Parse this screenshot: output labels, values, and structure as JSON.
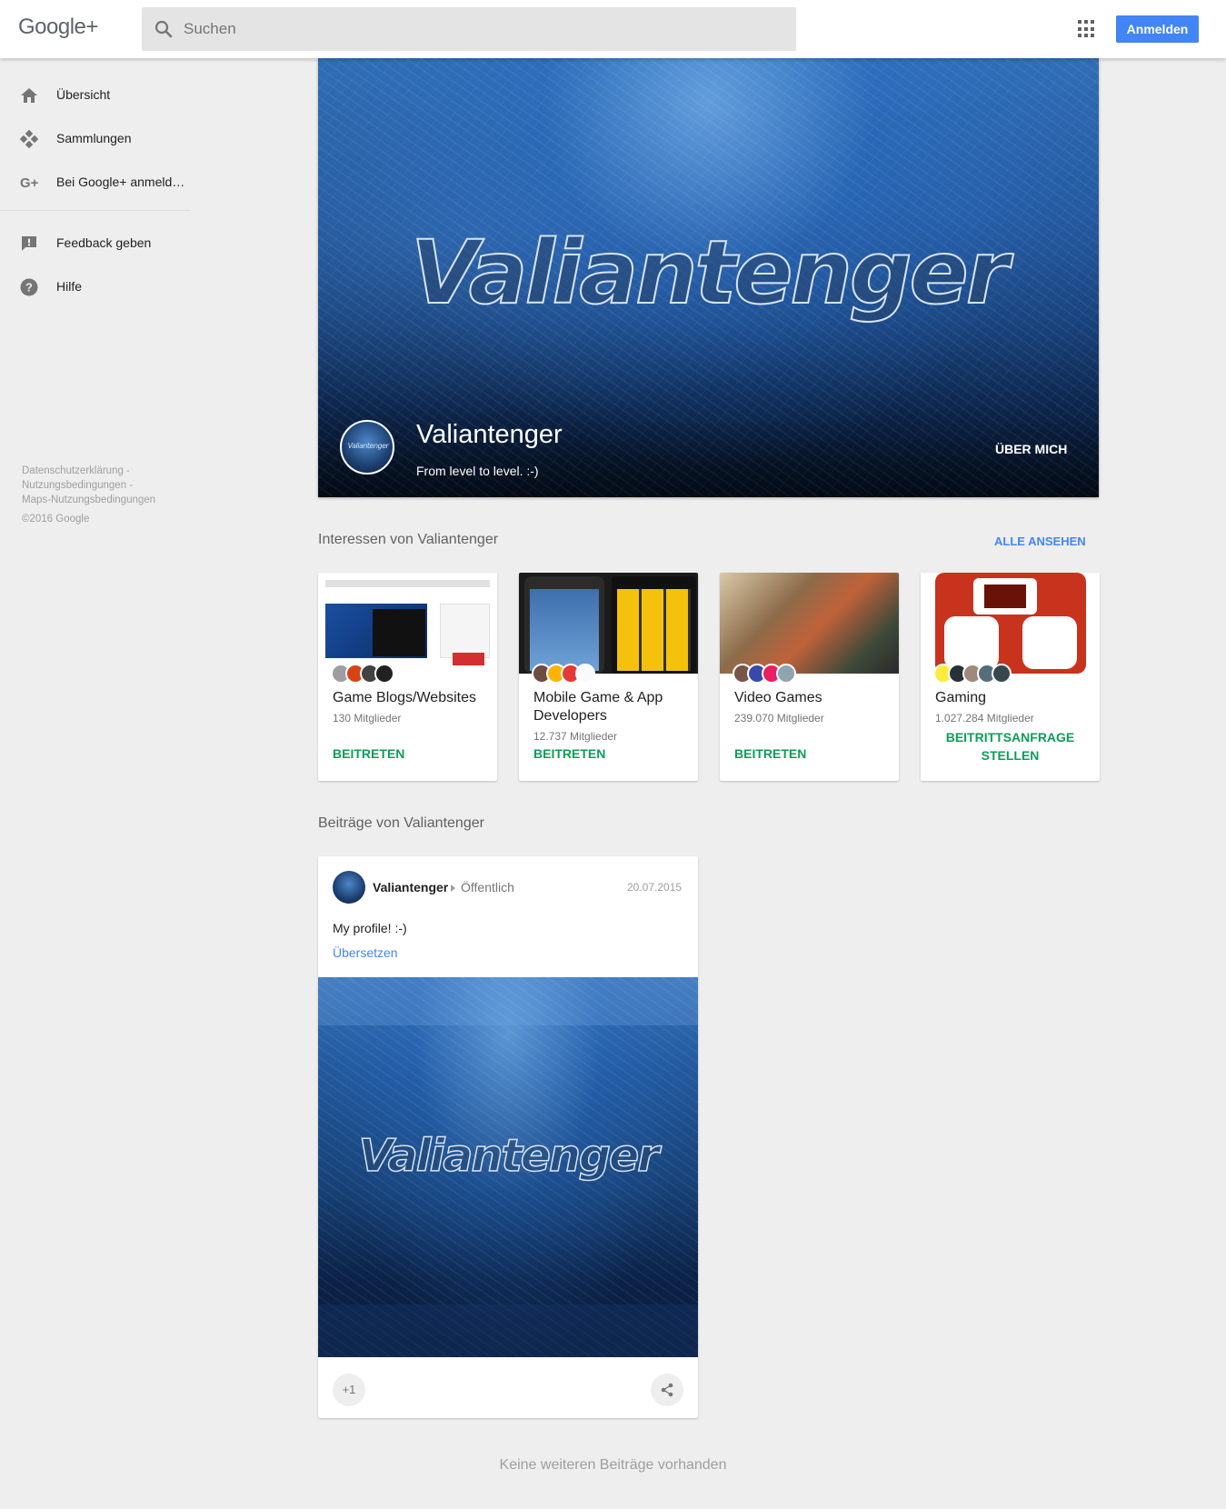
{
  "header": {
    "logo": "Google+",
    "search": {
      "placeholder": "Suchen"
    },
    "apps_icon": "apps-grid-icon",
    "signin_label": "Anmelden",
    "accent": "#4285f4"
  },
  "sidebar": {
    "items": [
      {
        "label": "Übersicht",
        "icon": "home-icon"
      },
      {
        "label": "Sammlungen",
        "icon": "collections-icon"
      },
      {
        "label": "Bei Google+ anmeld…",
        "icon": "google-plus-icon"
      },
      {
        "label": "Feedback geben",
        "icon": "feedback-icon"
      },
      {
        "label": "Hilfe",
        "icon": "help-icon"
      }
    ],
    "footer": {
      "links": [
        "Datenschutzerklärung -",
        "Nutzungsbedingungen -",
        "Maps-Nutzungsbedingungen"
      ],
      "copyright": "©2016 Google"
    }
  },
  "profile": {
    "cover_logo": "Valiantenger",
    "avatar_text": "Valiantenger",
    "name": "Valiantenger",
    "tagline": "From level to level. :-)",
    "about_label": "ÜBER MICH"
  },
  "interests": {
    "title": "Interessen von Valiantenger",
    "see_all": "ALLE ANSEHEN",
    "communities": [
      {
        "name": "Game Blogs/Websites",
        "members": "130 Mitglieder",
        "action": "BEITRETEN"
      },
      {
        "name": "Mobile Game & App Developers",
        "members": "12.737 Mitglieder",
        "action": "BEITRETEN"
      },
      {
        "name": "Video Games",
        "members": "239.070 Mitglieder",
        "action": "BEITRETEN"
      },
      {
        "name": "Gaming",
        "members": "1.027.284 Mitglieder",
        "action": "BEITRITTSANFRAGE STELLEN"
      }
    ],
    "action_color": "#0f9d58"
  },
  "posts": {
    "title": "Beiträge von Valiantenger",
    "items": [
      {
        "author": "Valiantenger",
        "visibility": "Öffentlich",
        "date": "20.07.2015",
        "text": "My profile! :-)",
        "translate": "Übersetzen",
        "image_logo": "Valiantenger",
        "plus_one": "+1",
        "share_icon": "share-icon"
      }
    ],
    "end_text": "Keine weiteren Beiträge vorhanden"
  }
}
